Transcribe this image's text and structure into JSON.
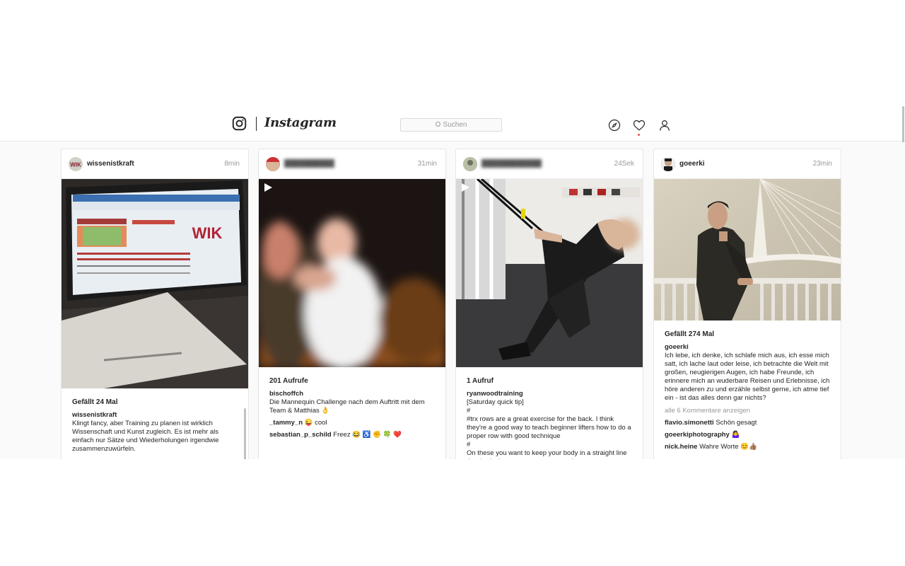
{
  "app": {
    "name": "Instagram"
  },
  "search": {
    "placeholder": "Suchen"
  },
  "colors": {
    "accent_notification": "#ed4956",
    "border": "#e6e6e6",
    "muted": "#999999"
  },
  "icons": [
    "instagram-camera-icon",
    "search-icon",
    "compass-icon",
    "heart-icon",
    "user-icon",
    "play-icon"
  ],
  "posts": [
    {
      "username": "wissenistkraft",
      "time": "8min",
      "stat": "Gefällt 24 Mal",
      "caption_user": "wissenistkraft",
      "caption": "Klingt fancy, aber Training zu planen ist wirklich Wissenschaft und Kunst zugleich. Es ist mehr als einfach nur Sätze und Wiederholungen irgendwie zusammenzuwürfeln.",
      "media_logo": "WIK"
    },
    {
      "username": "",
      "time": "31min",
      "stat": "201 Aufrufe",
      "caption_user": "bischoffch",
      "caption": "Die Mannequin Challenge nach dem Auftritt mit dem Team & Matthias 👌",
      "comments": [
        {
          "user": "_tammy_n",
          "text": "😜 cool"
        },
        {
          "user": "sebastian_p_schild",
          "text": "Freez 😂 ♿ ✊ 🍀 ❤️"
        }
      ]
    },
    {
      "username": "",
      "time": "24Sek",
      "stat": "1 Aufruf",
      "caption_user": "ryanwoodtraining",
      "caption_lines": [
        "[Saturday quick tip]",
        "#",
        "#trx rows are a great exercise for the back. I think they're a good way to teach beginner lifters how to do a proper row with good technique",
        "#",
        "On these you want to keep your body in a straight line thro body time, create some space but you"
      ]
    },
    {
      "username": "goeerki",
      "time": "23min",
      "stat": "Gefällt 274 Mal",
      "caption_user": "goeerki",
      "caption": "Ich lebe, ich denke, ich schlafe mich aus, ich esse mich satt, ich lache laut oder leise, ich betrachte die Welt mit großen, neugierigen Augen, ich habe Freunde, ich erinnere mich an wuderbare Reisen und Erlebnisse, ich höre anderen zu und erzähle selbst gerne, ich atme tief ein - ist das alles denn gar nichts?",
      "more_comments": "alle 6 Kommentare anzeigen",
      "comments": [
        {
          "user": "flavio.simonetti",
          "text": "Schön gesagt"
        },
        {
          "user": "goeerkiphotography",
          "text": "🤷‍♀️"
        },
        {
          "user": "nick.heine",
          "text": "Wahre Worte 😊👍🏽"
        }
      ]
    }
  ]
}
